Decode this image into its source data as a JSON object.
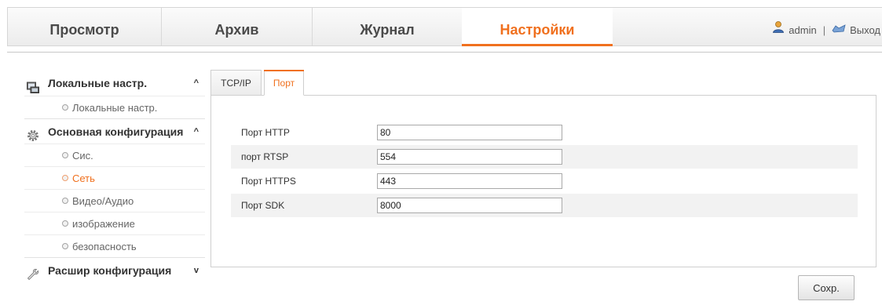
{
  "topnav": {
    "tabs": [
      {
        "label": "Просмотр"
      },
      {
        "label": "Архив"
      },
      {
        "label": "Журнал"
      },
      {
        "label": "Настройки"
      }
    ],
    "active_tab": "Настройки",
    "user": "admin",
    "separator": "|",
    "logout": "Выход",
    "accent_color": "#f0701e"
  },
  "sidebar": {
    "groups": [
      {
        "label": "Локальные настр.",
        "icon": "monitor-icon",
        "chevron": "^",
        "expanded": true,
        "items": [
          {
            "label": "Локальные настр."
          }
        ]
      },
      {
        "label": "Основная конфигурация",
        "icon": "gear-icon",
        "chevron": "^",
        "expanded": true,
        "items": [
          {
            "label": "Сис."
          },
          {
            "label": "Сеть"
          },
          {
            "label": "Видео/Аудио"
          },
          {
            "label": "изображение"
          },
          {
            "label": "безопасность"
          }
        ]
      },
      {
        "label": "Расшир конфигурация",
        "icon": "wrench-icon",
        "chevron": "v",
        "expanded": false
      }
    ],
    "active_item": "Сеть"
  },
  "content": {
    "tabs": [
      {
        "label": "TCP/IP"
      },
      {
        "label": "Порт"
      }
    ],
    "active_tab": "Порт",
    "fields": [
      {
        "label": "Порт HTTP",
        "value": "80"
      },
      {
        "label": "порт RTSP",
        "value": "554"
      },
      {
        "label": "Порт HTTPS",
        "value": "443"
      },
      {
        "label": "Порт SDK",
        "value": "8000"
      }
    ],
    "save_label": "Сохр."
  }
}
